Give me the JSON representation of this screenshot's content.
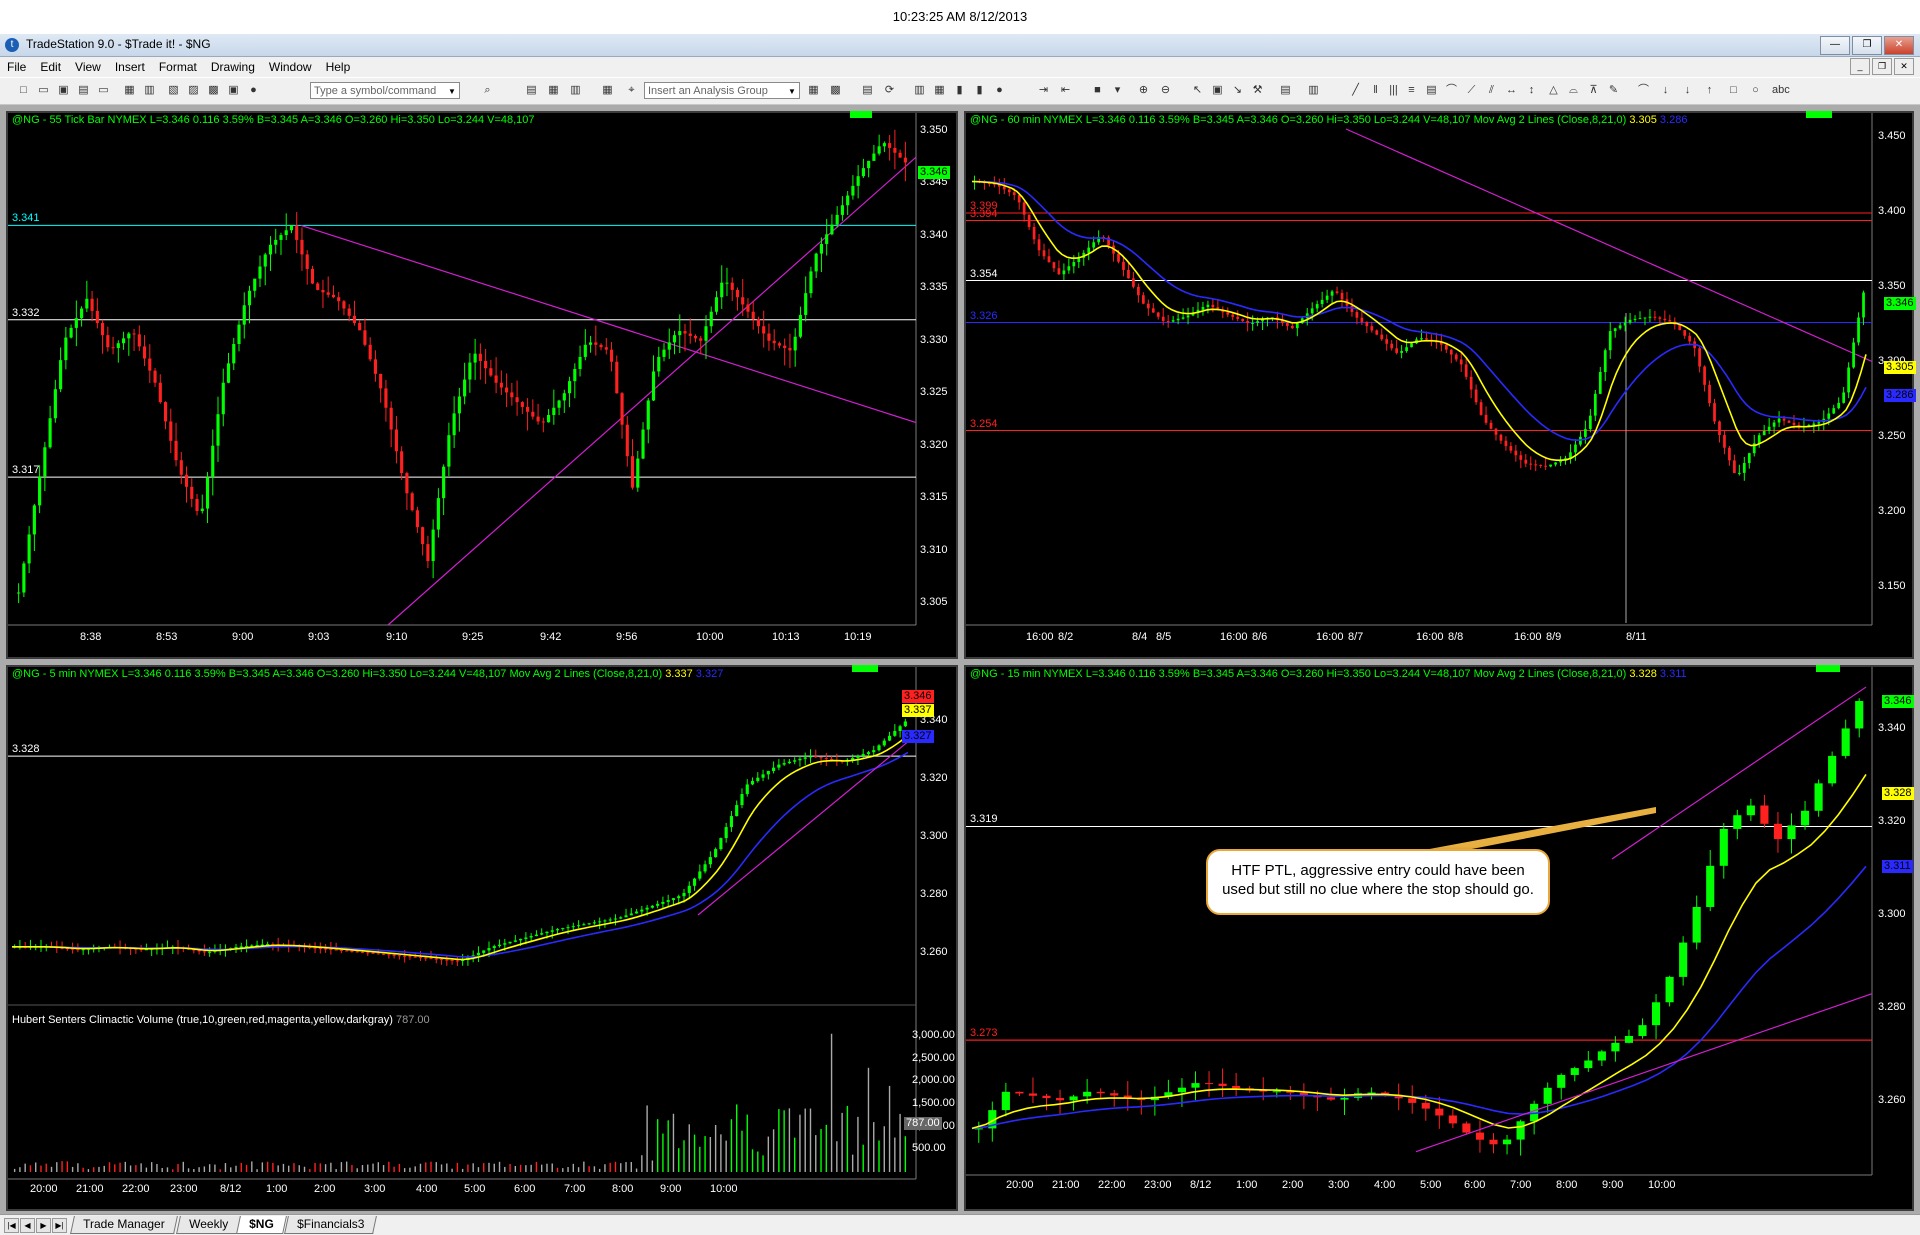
{
  "clock": "10:23:25 AM 8/12/2013",
  "app": {
    "title": "TradeStation 9.0 - $Trade it! - $NG",
    "menu": [
      "File",
      "Edit",
      "View",
      "Insert",
      "Format",
      "Drawing",
      "Window",
      "Help"
    ]
  },
  "toolbar": {
    "symbol_placeholder": "Type a symbol/command",
    "analysis_group_placeholder": "Insert an Analysis Group"
  },
  "charts": {
    "tick": {
      "symbol": "@NG - 55 Tick Bar",
      "quote": "NYMEX  L=3.346  0.116  3.59%  B=3.345  A=3.346  O=3.260  Hi=3.350  Lo=3.244  V=48,107",
      "price_axis": [
        "3.350",
        "3.345",
        "3.340",
        "3.335",
        "3.330",
        "3.325",
        "3.320",
        "3.315",
        "3.310",
        "3.305"
      ],
      "time_axis": [
        "8:38",
        "8:53",
        "9:00",
        "9:03",
        "9:10",
        "9:25",
        "9:42",
        "9:56",
        "10:00",
        "10:13",
        "10:19"
      ],
      "levels": [
        {
          "label": "3.341",
          "color": "#00ffff"
        },
        {
          "label": "3.332",
          "color": "#ffffff"
        },
        {
          "label": "3.317",
          "color": "#ffffff"
        }
      ],
      "last_tag": "3.346"
    },
    "hour": {
      "symbol": "@NG - 60 min",
      "quote": "NYMEX  L=3.346  0.116  3.59%  B=3.345  A=3.346  O=3.260  Hi=3.350  Lo=3.244  V=48,107  Mov Avg 2 Lines (Close,8,21,0)",
      "ma_fast": "3.305",
      "ma_slow": "3.286",
      "price_axis": [
        "3.450",
        "3.400",
        "3.350",
        "3.300",
        "3.250",
        "3.200",
        "3.150"
      ],
      "time_axis": [
        "16:00",
        "8/2",
        "8/4",
        "8/5",
        "16:00",
        "8/6",
        "16:00",
        "8/7",
        "16:00",
        "8/8",
        "16:00",
        "8/9",
        "8/11"
      ],
      "levels": [
        {
          "label": "3.399",
          "color": "#ff2020"
        },
        {
          "label": "3.394",
          "color": "#ff2020"
        },
        {
          "label": "3.354",
          "color": "#ffffff"
        },
        {
          "label": "3.326",
          "color": "#2a2aff"
        },
        {
          "label": "3.254",
          "color": "#ff2020"
        }
      ],
      "tags": [
        "3.346",
        "3.305",
        "3.286"
      ]
    },
    "five": {
      "symbol": "@NG - 5 min",
      "quote": "NYMEX  L=3.346  0.116  3.59%  B=3.345  A=3.346  O=3.260  Hi=3.350  Lo=3.244  V=48,107  Mov Avg 2 Lines (Close,8,21,0)",
      "ma_fast": "3.337",
      "ma_slow": "3.327",
      "price_axis": [
        "3.340",
        "3.320",
        "3.300",
        "3.280",
        "3.260"
      ],
      "time_axis": [
        "20:00",
        "21:00",
        "22:00",
        "23:00",
        "8/12",
        "1:00",
        "2:00",
        "3:00",
        "4:00",
        "5:00",
        "6:00",
        "7:00",
        "8:00",
        "9:00",
        "10:00"
      ],
      "levels": [
        {
          "label": "3.328",
          "color": "#ffffff"
        }
      ],
      "tags": [
        "3.346",
        "3.337",
        "3.327"
      ],
      "volume_label": "Hubert Senters Climactic Volume (true,10,green,red,magenta,yellow,darkgray)",
      "volume_value": "787.00",
      "volume_axis": [
        "3,000.00",
        "2,500.00",
        "2,000.00",
        "1,500.00",
        "1,000.00",
        "500.00"
      ],
      "volume_tag": "787.00"
    },
    "fifteen": {
      "symbol": "@NG - 15 min",
      "quote": "NYMEX  L=3.346  0.116  3.59%  B=3.345  A=3.346  O=3.260  Hi=3.350  Lo=3.244  V=48,107  Mov Avg 2 Lines (Close,8,21,0)",
      "ma_fast": "3.328",
      "ma_slow": "3.311",
      "price_axis": [
        "3.340",
        "3.320",
        "3.300",
        "3.280",
        "3.260"
      ],
      "time_axis": [
        "20:00",
        "21:00",
        "22:00",
        "23:00",
        "8/12",
        "1:00",
        "2:00",
        "3:00",
        "4:00",
        "5:00",
        "6:00",
        "7:00",
        "8:00",
        "9:00",
        "10:00"
      ],
      "levels": [
        {
          "label": "3.319",
          "color": "#ffffff"
        },
        {
          "label": "3.273",
          "color": "#ff2020"
        }
      ],
      "tags": [
        "3.346",
        "3.328",
        "3.311"
      ],
      "callout": "HTF PTL, aggressive entry could have been used but still no clue where the stop should go."
    }
  },
  "workspace_tabs": [
    "Trade Manager",
    "Weekly",
    "$NG",
    "$Financials3"
  ],
  "active_tab": "$NG"
}
